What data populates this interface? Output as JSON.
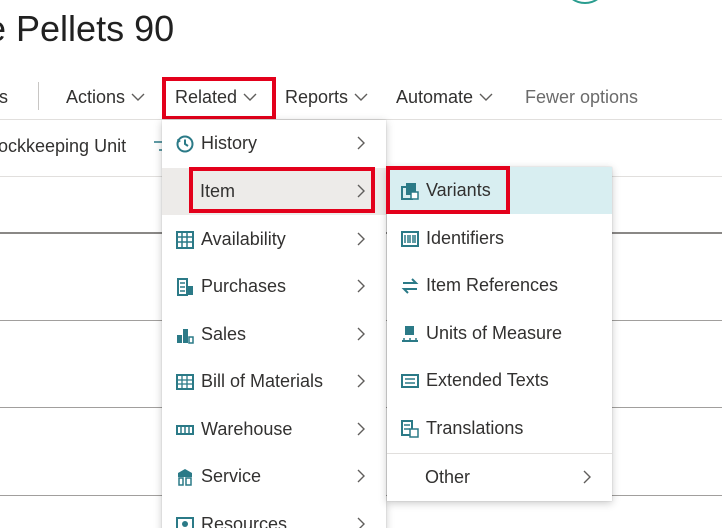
{
  "page": {
    "title": "e Pellets 90"
  },
  "action_bar": {
    "items": [
      {
        "label": "ts"
      },
      {
        "label": "Actions"
      },
      {
        "label": "Related"
      },
      {
        "label": "Reports"
      },
      {
        "label": "Automate"
      },
      {
        "label": "Fewer options"
      }
    ]
  },
  "promoted": {
    "label": "ockkeeping Unit"
  },
  "related_menu": {
    "items": [
      {
        "label": "History",
        "icon": "history-icon"
      },
      {
        "label": "Item",
        "icon": ""
      },
      {
        "label": "Availability",
        "icon": "availability-icon"
      },
      {
        "label": "Purchases",
        "icon": "purchases-icon"
      },
      {
        "label": "Sales",
        "icon": "sales-icon"
      },
      {
        "label": "Bill of Materials",
        "icon": "bill-of-materials-icon"
      },
      {
        "label": "Warehouse",
        "icon": "warehouse-icon"
      },
      {
        "label": "Service",
        "icon": "service-icon"
      },
      {
        "label": "Resources",
        "icon": "resources-icon"
      }
    ]
  },
  "item_submenu": {
    "items": [
      {
        "label": "Variants",
        "icon": "variants-icon"
      },
      {
        "label": "Identifiers",
        "icon": "barcode-icon"
      },
      {
        "label": "Item References",
        "icon": "swap-arrows-icon"
      },
      {
        "label": "Units of Measure",
        "icon": "units-of-measure-icon"
      },
      {
        "label": "Extended Texts",
        "icon": "extended-texts-icon"
      },
      {
        "label": "Translations",
        "icon": "translations-icon"
      },
      {
        "label": "Other",
        "icon": ""
      }
    ]
  },
  "colors": {
    "accent": "#2b7a87",
    "highlight_outline": "#e3001b",
    "hover_grey": "#edebe9",
    "selected_teal": "#d8eef1"
  }
}
